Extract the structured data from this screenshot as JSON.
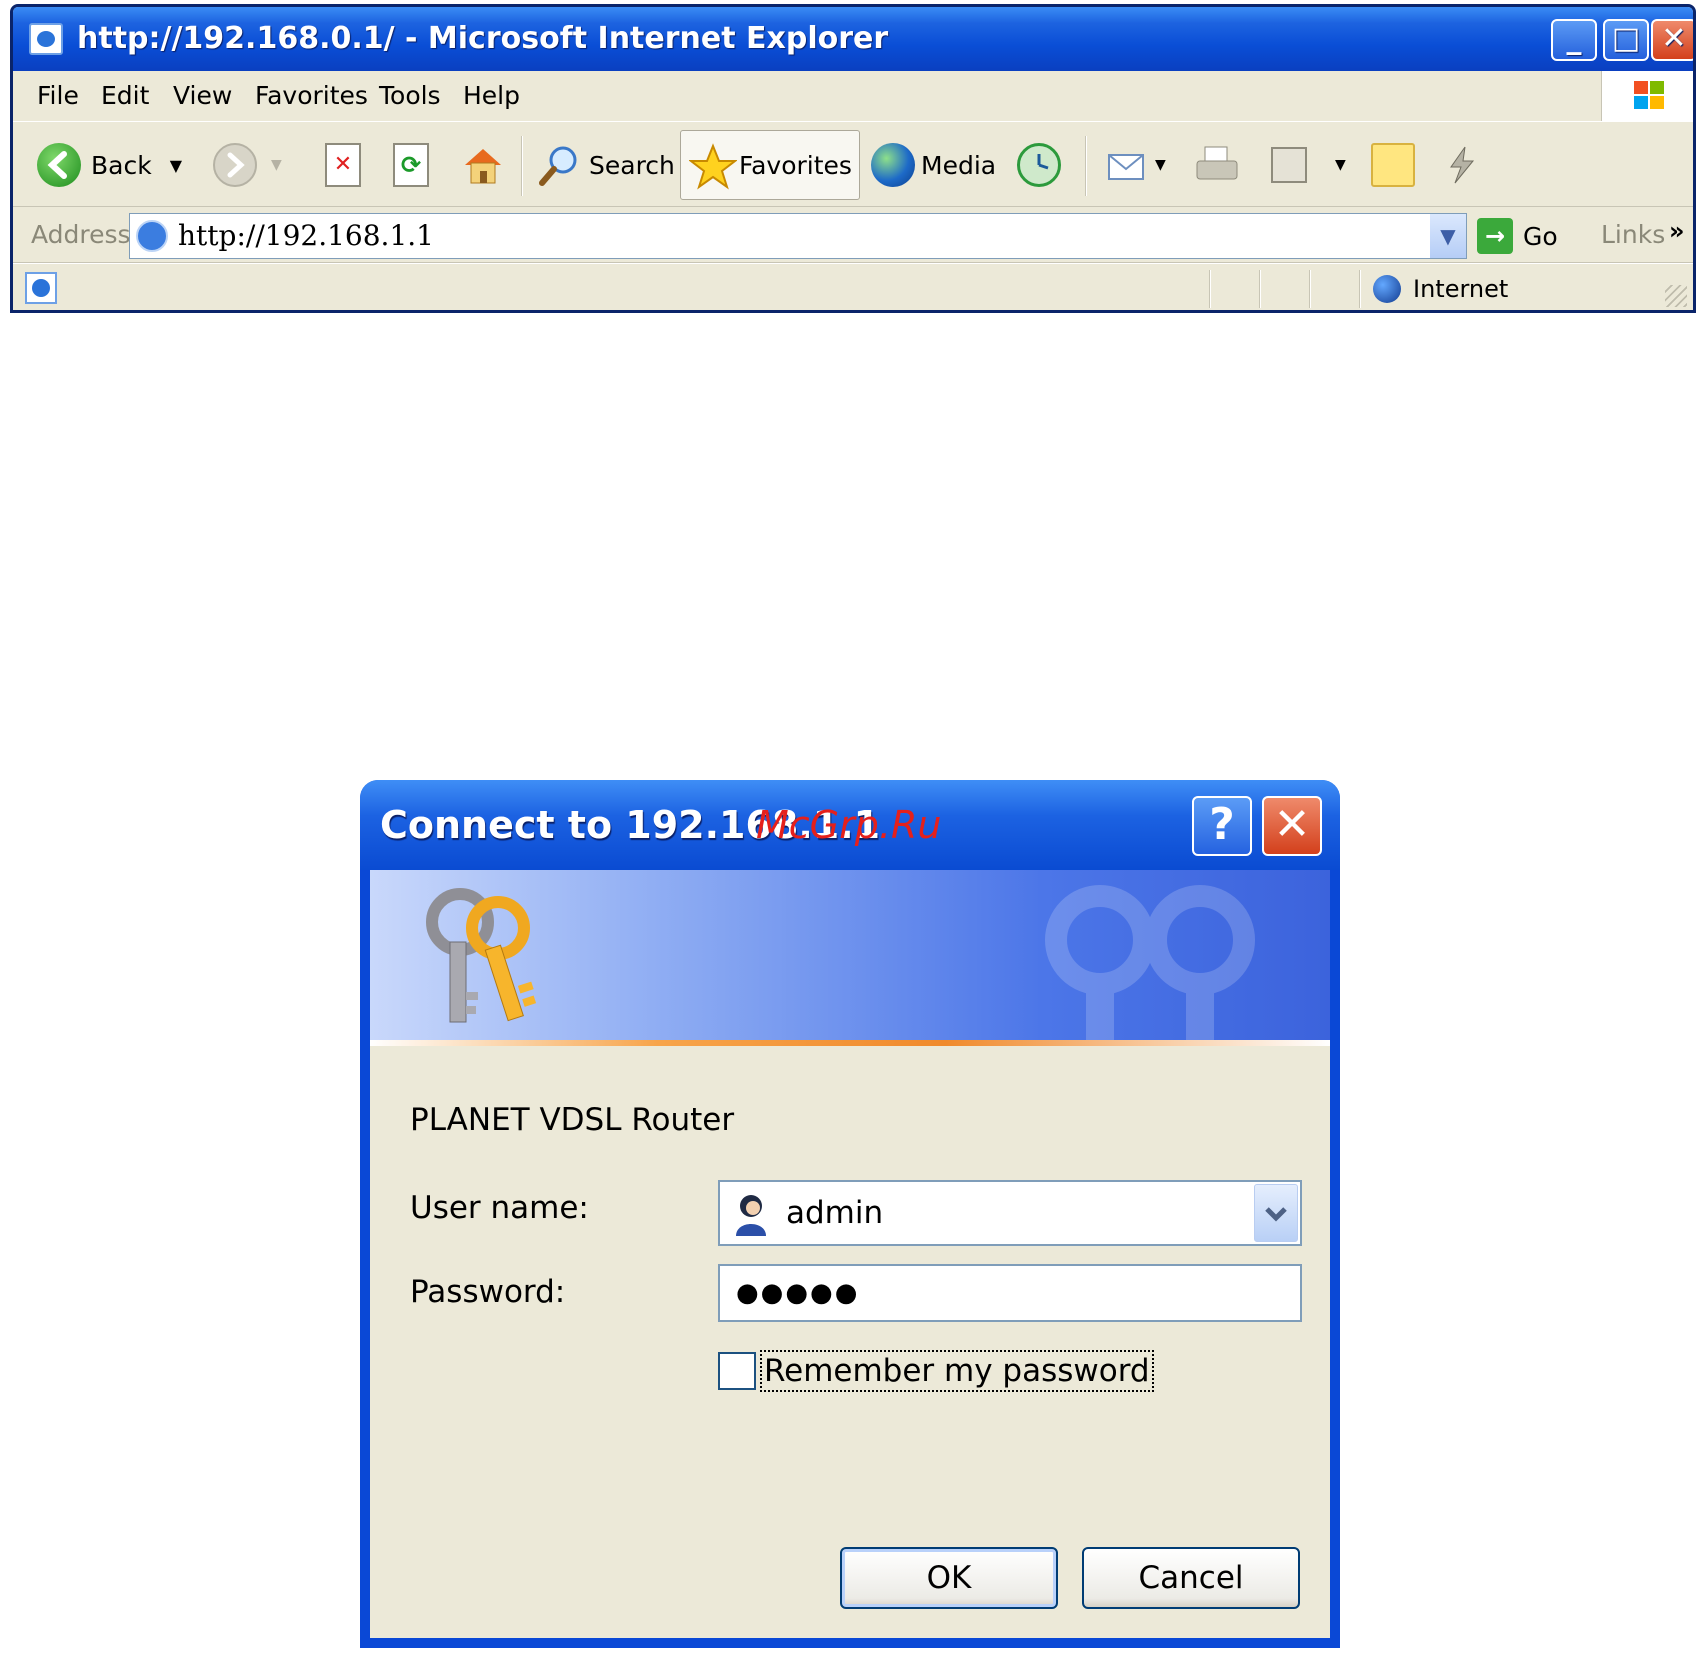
{
  "ie": {
    "title": "http://192.168.0.1/ - Microsoft Internet Explorer",
    "window_buttons": {
      "minimize": "_",
      "maximize": "□",
      "close": "✕"
    },
    "menu": [
      "File",
      "Edit",
      "View",
      "Favorites",
      "Tools",
      "Help"
    ],
    "toolbar": {
      "back": "Back",
      "search": "Search",
      "favorites": "Favorites",
      "media": "Media"
    },
    "address": {
      "label": "Address",
      "url": "http://192.168.1.1",
      "go": "Go",
      "links": "Links",
      "chevron": "»"
    },
    "status": {
      "zone": "Internet"
    }
  },
  "dialog": {
    "title": "Connect to 192.168.1.1",
    "watermark": "McGrp.Ru",
    "help": "?",
    "close": "✕",
    "realm": "PLANET VDSL Router",
    "username_label": "User name:",
    "username_value": "admin",
    "password_label": "Password:",
    "password_value": "●●●●●",
    "remember_label": "Remember my password",
    "remember_checked": false,
    "ok": "OK",
    "cancel": "Cancel"
  },
  "colors": {
    "xp_titlebar": "#0a4ed6",
    "xp_face": "#ece9d8",
    "xp_close": "#d3401c",
    "watermark": "#e5201c"
  }
}
